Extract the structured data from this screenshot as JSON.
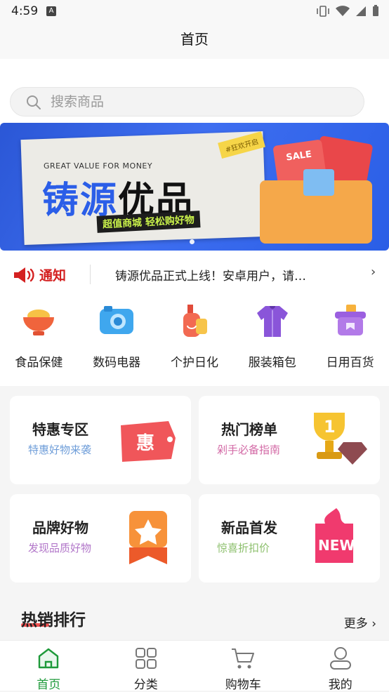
{
  "status_bar": {
    "time": "4:59",
    "a_badge": "A"
  },
  "header": {
    "title": "首页"
  },
  "search": {
    "placeholder": "搜索商品"
  },
  "banner": {
    "tagline": "GREAT VALUE FOR MONEY",
    "title_part1": "铸源",
    "title_part2": "优品",
    "slogan": "超值商城 轻松购好物",
    "sticker": "#狂欢开启",
    "sale_tag": "SALE"
  },
  "notice": {
    "label": "通知",
    "text": "铸源优品正式上线！安卓用户，请…"
  },
  "categories": [
    {
      "label": "食品保健",
      "icon": "food-bowl-icon"
    },
    {
      "label": "数码电器",
      "icon": "camera-icon"
    },
    {
      "label": "个护日化",
      "icon": "lotion-bottle-icon"
    },
    {
      "label": "服装箱包",
      "icon": "jacket-icon"
    },
    {
      "label": "日用百货",
      "icon": "basket-icon"
    }
  ],
  "promos": [
    {
      "title": "特惠专区",
      "subtitle": "特惠好物来袭",
      "badge": "惠",
      "subtitle_color": "#6f9ed9"
    },
    {
      "title": "热门榜单",
      "subtitle": "剁手必备指南",
      "badge": "1",
      "subtitle_color": "#d36aa6"
    },
    {
      "title": "品牌好物",
      "subtitle": "发现品质好物",
      "subtitle_color": "#b277c9"
    },
    {
      "title": "新品首发",
      "subtitle": "惊喜折扣价",
      "badge": "NEW",
      "subtitle_color": "#8cbf6c"
    }
  ],
  "hot": {
    "title": "热销排行",
    "more": "更多"
  },
  "tabs": [
    {
      "label": "首页",
      "icon": "home-icon",
      "active": true
    },
    {
      "label": "分类",
      "icon": "grid-icon"
    },
    {
      "label": "购物车",
      "icon": "cart-icon"
    },
    {
      "label": "我的",
      "icon": "user-icon"
    }
  ],
  "colors": {
    "accent_green": "#1e9a3a",
    "notice_red": "#d42020",
    "banner_blue": "#2b5ee8"
  }
}
